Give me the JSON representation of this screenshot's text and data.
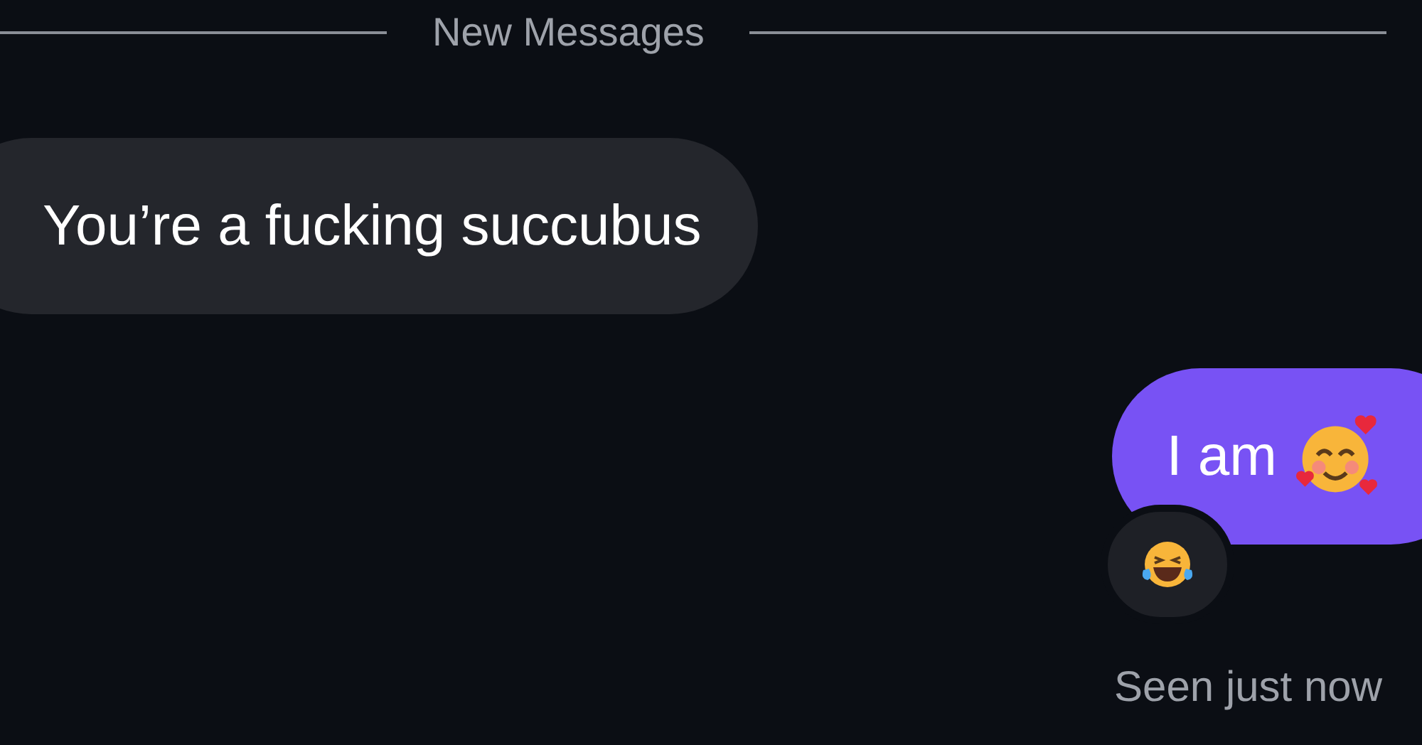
{
  "divider": {
    "label": "New Messages"
  },
  "messages": [
    {
      "kind": "received",
      "text": "You’re a fucking succubus"
    },
    {
      "kind": "sent",
      "text": "I am",
      "emoji": true,
      "reaction": true
    }
  ],
  "status": "Seen just now"
}
